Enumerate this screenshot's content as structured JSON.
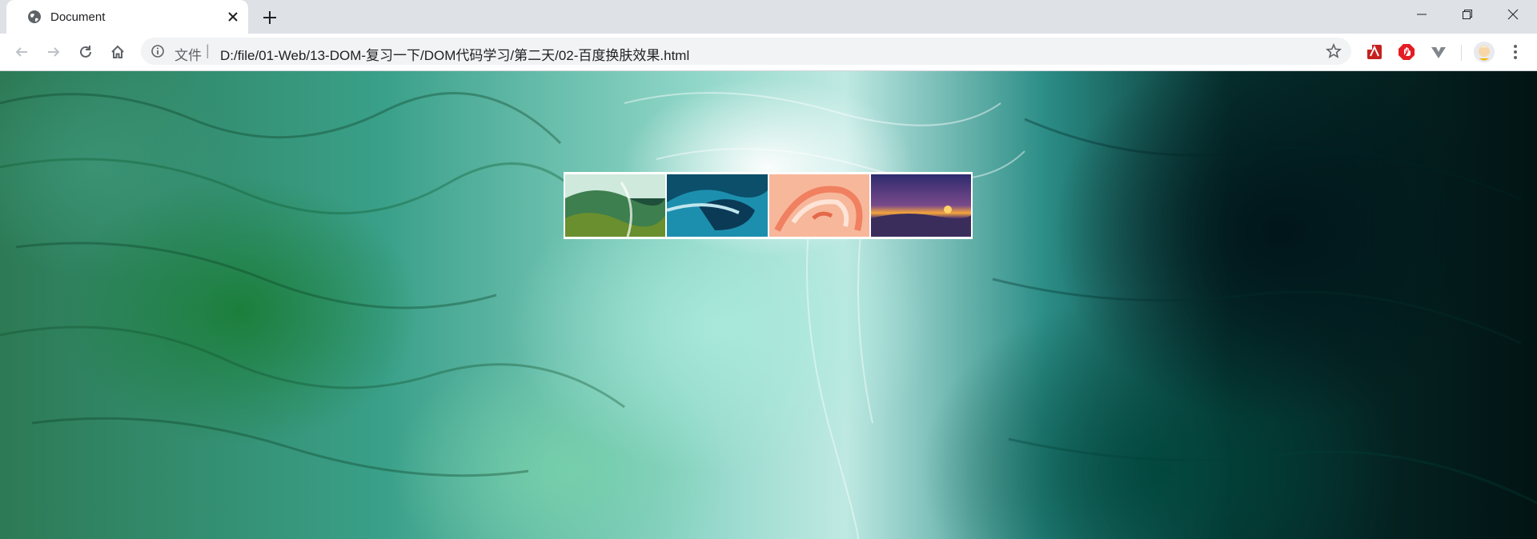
{
  "tab": {
    "title": "Document",
    "favicon": "globe-icon"
  },
  "window_controls": [
    "minimize-icon",
    "maximize-icon",
    "close-icon"
  ],
  "toolbar": {
    "buttons": [
      "back-icon",
      "forward-icon",
      "reload-icon",
      "home-icon"
    ],
    "omnibox": {
      "scheme_label": "文件",
      "separator": "|",
      "url": "D:/file/01-Web/13-DOM-复习一下/DOM代码学习/第二天/02-百度换肤效果.html"
    },
    "extensions": [
      "pdf-extension-icon",
      "adblock-icon",
      "vpn-extension-icon",
      "profile-avatar-icon",
      "menu-icon"
    ]
  },
  "page": {
    "skin_thumbnails": [
      {
        "name": "skin-thumb-water",
        "colors": [
          "#2f6b3c",
          "#5fa27a",
          "#cfe9dc"
        ]
      },
      {
        "name": "skin-thumb-wave",
        "colors": [
          "#0a4f6b",
          "#1f8ca8",
          "#bfe6ef"
        ]
      },
      {
        "name": "skin-thumb-flamingo",
        "colors": [
          "#f28a6a",
          "#f7b79b",
          "#fde4d6"
        ]
      },
      {
        "name": "skin-thumb-sunset",
        "colors": [
          "#2d2b6e",
          "#7a4a8a",
          "#f6a53b"
        ]
      }
    ]
  },
  "colors": {
    "tabstrip": "#dee1e6",
    "toolbar": "#ffffff",
    "omnibox": "#f1f3f4"
  }
}
